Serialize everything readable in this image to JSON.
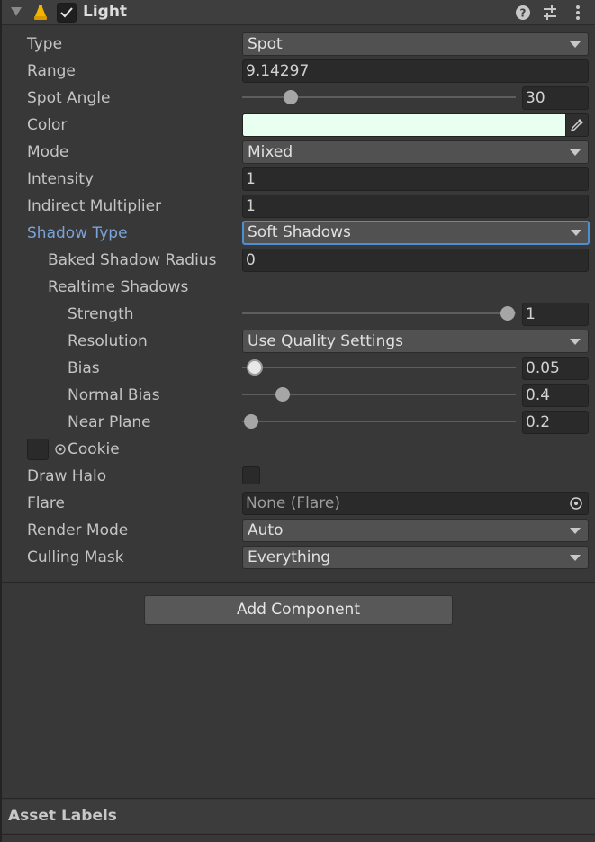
{
  "component": {
    "title": "Light",
    "enabled": true,
    "icons": [
      "help-icon",
      "preset-icon",
      "kebab-menu-icon"
    ]
  },
  "fields": {
    "type": {
      "label": "Type",
      "value": "Spot"
    },
    "range": {
      "label": "Range",
      "value": "9.14297"
    },
    "spot_angle": {
      "label": "Spot Angle",
      "value": "30"
    },
    "color": {
      "label": "Color",
      "hex": "#e8fff2"
    },
    "mode": {
      "label": "Mode",
      "value": "Mixed"
    },
    "intensity": {
      "label": "Intensity",
      "value": "1"
    },
    "indirect_multiplier": {
      "label": "Indirect Multiplier",
      "value": "1"
    },
    "shadow_type": {
      "label": "Shadow Type",
      "value": "Soft Shadows"
    },
    "baked_shadow_radius": {
      "label": "Baked Shadow Radius",
      "value": "0"
    },
    "realtime_shadows": {
      "label": "Realtime Shadows"
    },
    "strength": {
      "label": "Strength",
      "value": "1"
    },
    "resolution": {
      "label": "Resolution",
      "value": "Use Quality Settings"
    },
    "bias": {
      "label": "Bias",
      "value": "0.05"
    },
    "normal_bias": {
      "label": "Normal Bias",
      "value": "0.4"
    },
    "near_plane": {
      "label": "Near Plane",
      "value": "0.2"
    },
    "cookie": {
      "label": "Cookie"
    },
    "draw_halo": {
      "label": "Draw Halo",
      "checked": false
    },
    "flare": {
      "label": "Flare",
      "value": "None (Flare)"
    },
    "render_mode": {
      "label": "Render Mode",
      "value": "Auto"
    },
    "culling_mask": {
      "label": "Culling Mask",
      "value": "Everything"
    }
  },
  "add_component_label": "Add Component",
  "asset_labels": "Asset Labels",
  "colors": {
    "background": "#383838",
    "accent_blue": "#7ba3d8",
    "focus_border": "#4b8fd6"
  }
}
